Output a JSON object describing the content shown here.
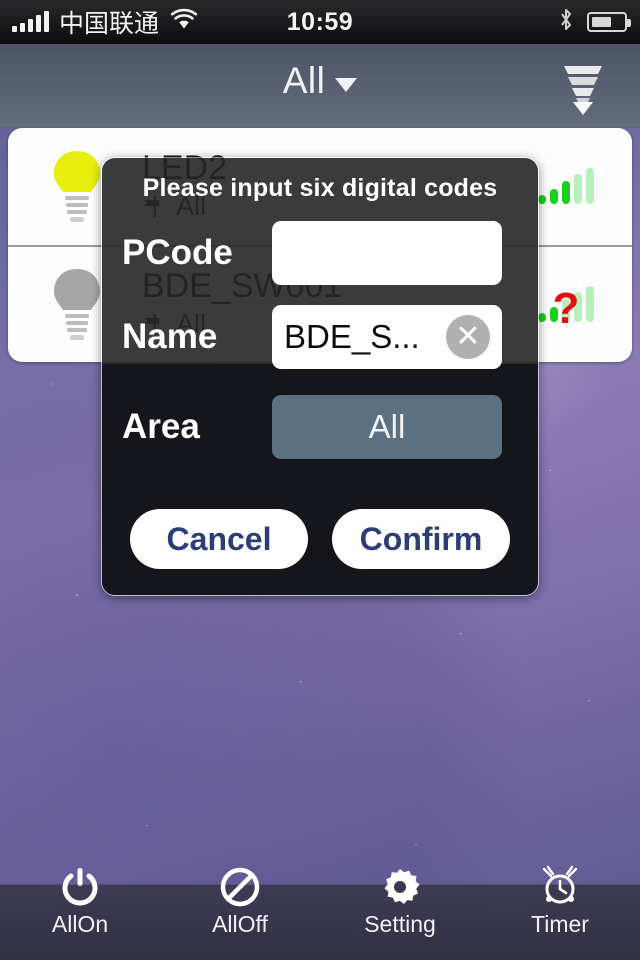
{
  "status_bar": {
    "carrier": "中国联通",
    "time": "10:59",
    "signal_icon": "signal-bars-icon",
    "wifi_icon": "wifi-icon",
    "bluetooth_icon": "bluetooth-icon",
    "battery_icon": "battery-icon"
  },
  "header": {
    "title": "All",
    "caret_icon": "chevron-down-icon",
    "filter_icon": "funnel-filter-icon"
  },
  "device_list": {
    "rows": [
      {
        "name": "LED2",
        "area": "All",
        "bulb_state": "on",
        "bulb_color": "#e8ee0c",
        "signal_icon": "signal-strength-icon",
        "signal_bars_active": 3,
        "signal_bars_total": 5,
        "status": "online"
      },
      {
        "name": "BDE_SW001",
        "area": "All",
        "bulb_state": "off",
        "bulb_color": "#a6a6a6",
        "signal_icon": "signal-unknown-icon",
        "signal_bars_active": 1,
        "signal_bars_total": 5,
        "status": "unknown",
        "status_marker": "?",
        "status_color": "#e11010"
      }
    ]
  },
  "dialog": {
    "title": "Please input six digital codes",
    "pcode": {
      "label": "PCode",
      "value": "",
      "placeholder": ""
    },
    "name": {
      "label": "Name",
      "value": "BDE_S...",
      "placeholder": "",
      "clear_icon": "clear-circle-icon"
    },
    "area": {
      "label": "Area",
      "value": "All",
      "options": [
        "All"
      ]
    },
    "cancel_label": "Cancel",
    "confirm_label": "Confirm",
    "accent_color": "#2c3e75",
    "area_button_color": "#5b7081"
  },
  "tab_bar": {
    "items": [
      {
        "label": "AllOn",
        "icon": "power-icon"
      },
      {
        "label": "AllOff",
        "icon": "prohibited-icon"
      },
      {
        "label": "Setting",
        "icon": "gear-icon"
      },
      {
        "label": "Timer",
        "icon": "alarm-clock-icon"
      }
    ]
  }
}
